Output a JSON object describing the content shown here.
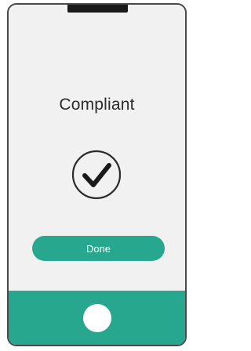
{
  "screen": {
    "title": "Compliant",
    "status_icon": "check-circle-icon"
  },
  "actions": {
    "done_label": "Done"
  },
  "device": {
    "home_icon": "home-button-icon"
  },
  "colors": {
    "accent": "#27a88e",
    "frame": "#4a4a4a",
    "screen_bg": "#f1f1f1",
    "text": "#2b2b2b"
  }
}
